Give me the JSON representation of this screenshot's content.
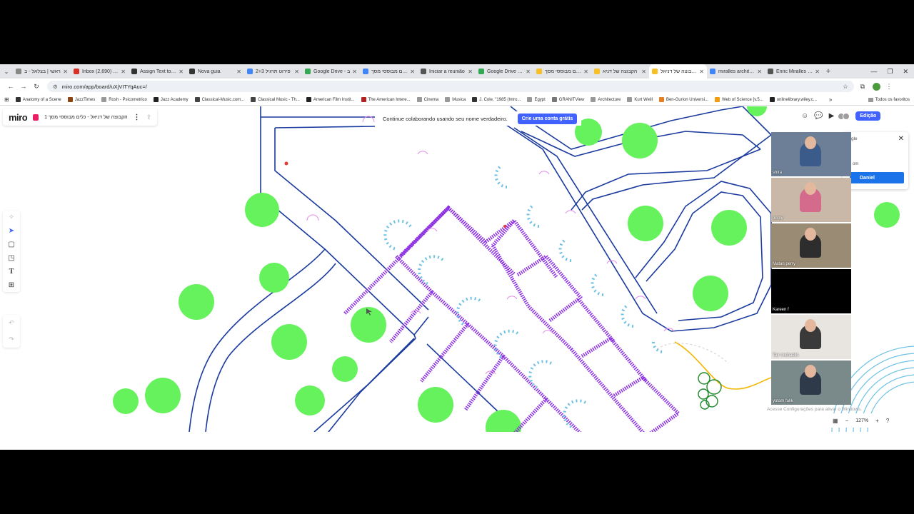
{
  "browser": {
    "tabs": [
      {
        "title": "ראשי | בצלאל - ב",
        "color": "#888888"
      },
      {
        "title": "Inbox (2,690) - d",
        "color": "#d93025"
      },
      {
        "title": "Assign Text to La",
        "color": "#333333"
      },
      {
        "title": "Nova guia",
        "color": "#333333"
      },
      {
        "title": "פירוט תרגיל 2+3",
        "color": "#4285f4"
      },
      {
        "title": "Google Drive - ב",
        "color": "#34a853"
      },
      {
        "title": "כלים מבוססי מסך",
        "color": "#4285f4"
      },
      {
        "title": "Iniciar a reunião",
        "color": "#555555"
      },
      {
        "title": "Google Drive - ה",
        "color": "#34a853"
      },
      {
        "title": "כלים מבוססי מסך",
        "color": "#f6c026"
      },
      {
        "title": "הקבוצה של דניא",
        "color": "#f6c026"
      },
      {
        "title": "הקבוצה של דניאל",
        "color": "#f6c026"
      },
      {
        "title": "miralles architect",
        "color": "#4285f4"
      },
      {
        "title": "Enric Miralles & C",
        "color": "#555555"
      }
    ],
    "active_tab_index": 11,
    "url": "miro.com/app/board/uXjVITYqAuc=/",
    "bookmarks": [
      {
        "label": "Anatomy of a Scene",
        "color": "#333333"
      },
      {
        "label": "JazzTimes",
        "color": "#8b4513"
      },
      {
        "label": "Rosh - Psicometrico",
        "color": "#999999"
      },
      {
        "label": "Jazz Academy",
        "color": "#222222"
      },
      {
        "label": "Classical-Music.com...",
        "color": "#444444"
      },
      {
        "label": "Classical Music - Th...",
        "color": "#444444"
      },
      {
        "label": "American Film Instit...",
        "color": "#222222"
      },
      {
        "label": "The American Intere...",
        "color": "#b22222"
      },
      {
        "label": "Cinema",
        "color": "#999999"
      },
      {
        "label": "Musica",
        "color": "#999999"
      },
      {
        "label": "J. Cole, \"1985 (Intro...",
        "color": "#333333"
      },
      {
        "label": "Egypt",
        "color": "#999999"
      },
      {
        "label": "GRANITView",
        "color": "#777777"
      },
      {
        "label": "Architecture",
        "color": "#999999"
      },
      {
        "label": "Kurt Weill",
        "color": "#999999"
      },
      {
        "label": "Ben-Gurion Universi...",
        "color": "#e67e22"
      },
      {
        "label": "Web of Science [v.5...",
        "color": "#f39c12"
      },
      {
        "label": "onlinelibrary.wiley.c...",
        "color": "#222222"
      }
    ],
    "all_bookmarks": "Todos os favoritos"
  },
  "miro": {
    "logo": "miro",
    "board_name": "1 הקבוצה של דניאל - כלים מבוססי מסך",
    "banner_text": "Continue colaborando usando seu nome verdadeiro.",
    "banner_button": "Crie uma conta grátis",
    "edit_button": "Edição",
    "zoom": "127%",
    "windows_watermark": "Acesse Configurações para ativar o Windows."
  },
  "participants": [
    {
      "name": "shira",
      "bg": "#6d7f96",
      "shirt": "#3b5b8a"
    },
    {
      "name": "orimy",
      "bg": "#c9b8a8",
      "shirt": "#d46a8c"
    },
    {
      "name": "Matan perry",
      "bg": "#9a8b74",
      "shirt": "#2d2d2d"
    },
    {
      "name": "Kareen f",
      "bg": "#000000",
      "shirt": "#000000"
    },
    {
      "name": "Tair michaelis",
      "bg": "#e8e4e0",
      "shirt": "#3a3a3a"
    },
    {
      "name": "yotam falik",
      "bg": "#7a8a8a",
      "shirt": "#2e3a4a"
    }
  ],
  "popup": {
    "title": "gle",
    "email": "om",
    "button": "Daniel"
  },
  "colors": {
    "path_outline": "#1a3a9e",
    "tree": "#66f25c",
    "building": "#8a2be2",
    "circles": "#6ec1e4",
    "accent": "#4262ff",
    "yellow_path": "#f2b600"
  }
}
